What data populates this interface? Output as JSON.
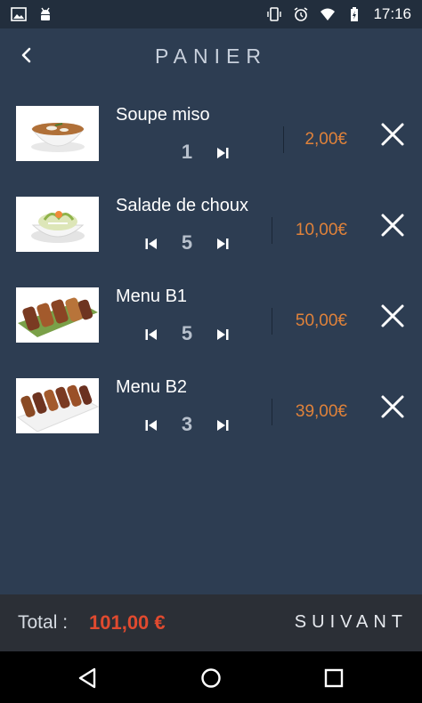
{
  "status_bar": {
    "time": "17:16",
    "left_icons": [
      "image-icon",
      "android-icon"
    ],
    "right_icons": [
      "vibrate-icon",
      "alarm-icon",
      "wifi-icon",
      "battery-charging-icon"
    ]
  },
  "header": {
    "title": "PANIER",
    "back_icon": "chevron-left-icon"
  },
  "cart": {
    "items": [
      {
        "name": "Soupe miso",
        "quantity": "1",
        "price": "2,00€",
        "has_prev": false
      },
      {
        "name": "Salade de choux",
        "quantity": "5",
        "price": "10,00€",
        "has_prev": true
      },
      {
        "name": "Menu B1",
        "quantity": "5",
        "price": "50,00€",
        "has_prev": true
      },
      {
        "name": "Menu B2",
        "quantity": "3",
        "price": "39,00€",
        "has_prev": true
      }
    ]
  },
  "footer": {
    "total_label": "Total :",
    "total_value": "101,00 €",
    "next_label": "SUIVANT"
  },
  "colors": {
    "background": "#2d3d52",
    "price": "#e0823a",
    "total": "#e04a2f"
  }
}
